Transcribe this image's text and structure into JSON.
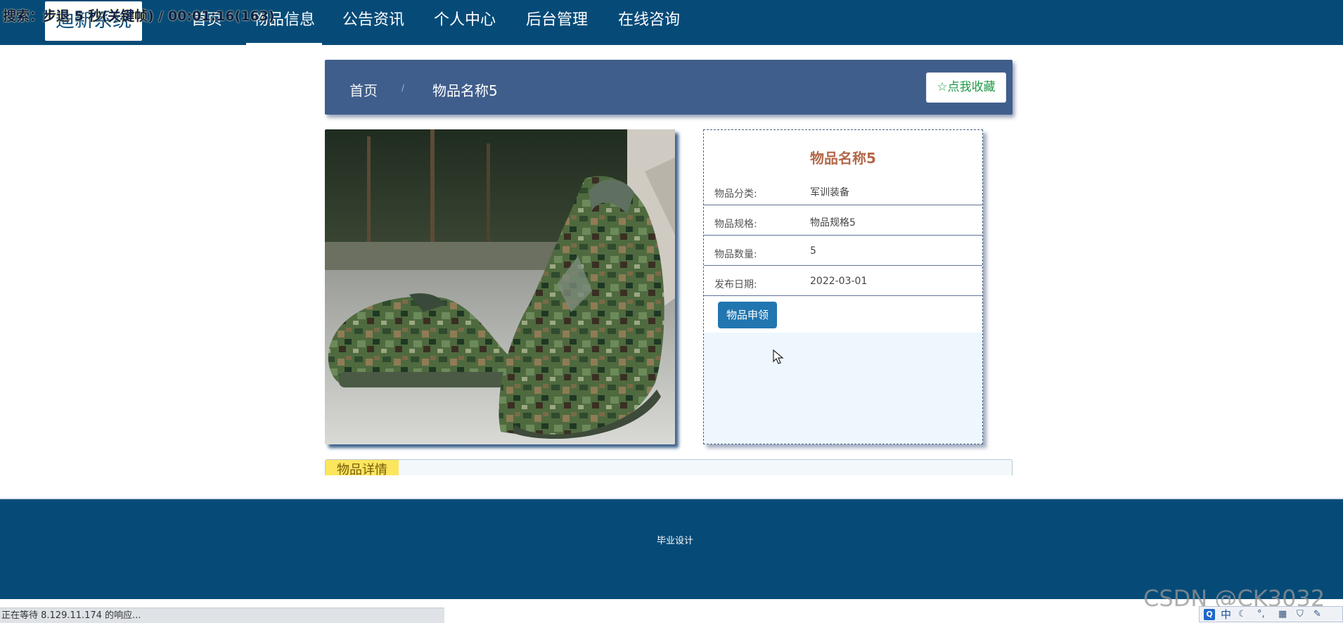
{
  "header": {
    "logo_text": "迪新系统",
    "nav_items": [
      "首页",
      "物品信息",
      "公告资讯",
      "个人中心",
      "后台管理",
      "在线咨询"
    ],
    "active_nav": "物品信息"
  },
  "overlay": {
    "text": "搜索：步退 5 秒(关键帧) / 00:01:16(163)"
  },
  "breadcrumb": {
    "home": "首页",
    "separator": "/",
    "current": "物品名称5",
    "favorite_label": "☆点我收藏"
  },
  "product": {
    "image_icon": "camo-sneaker-photo",
    "title": "物品名称5",
    "fields": [
      {
        "label": "物品分类:",
        "value": "军训装备"
      },
      {
        "label": "物品规格:",
        "value": "物品规格5"
      },
      {
        "label": "物品数量:",
        "value": "5"
      },
      {
        "label": "发布日期:",
        "value": "2022-03-01"
      }
    ],
    "apply_label": "物品申领"
  },
  "details_tab": {
    "label": "物品详情"
  },
  "footer": {
    "text": "毕业设计"
  },
  "status_bar": {
    "text": "正在等待 8.129.11.174 的响应..."
  },
  "watermark": {
    "text": "CSDN @CK3032"
  },
  "ime": {
    "logo_letter": "Q",
    "mode": "中"
  },
  "colors": {
    "nav_bg": "#064b78",
    "breadcrumb_bg": "#405e8c",
    "title_color": "#b36849",
    "button_blue": "#2176b0",
    "favorite_green": "#1e9a47",
    "tab_yellow": "#fbe65e"
  }
}
